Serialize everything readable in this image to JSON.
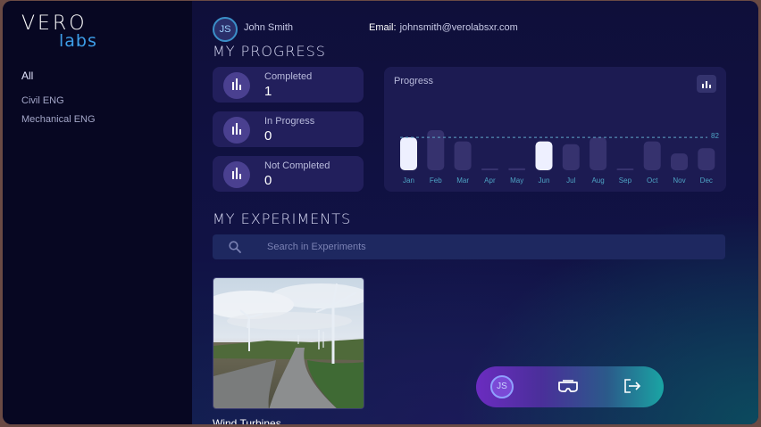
{
  "brand": {
    "name_top": "VERO",
    "name_bottom": "labs"
  },
  "sidebar": {
    "items": [
      {
        "label": "All",
        "active": true
      },
      {
        "label": "Civil ENG",
        "active": false
      },
      {
        "label": "Mechanical ENG",
        "active": false
      }
    ]
  },
  "user": {
    "initials": "JS",
    "name": "John Smith",
    "email_label": "Email:",
    "email": "johnsmith@verolabsxr.com"
  },
  "progress_section": {
    "title": "MY PROGRESS",
    "stats": [
      {
        "label": "Completed",
        "value": "1"
      },
      {
        "label": "In Progress",
        "value": "0"
      },
      {
        "label": "Not Completed",
        "value": "0"
      }
    ]
  },
  "chart_data": {
    "type": "bar",
    "title": "Progress",
    "categories": [
      "Jan",
      "Feb",
      "Mar",
      "Apr",
      "May",
      "Jun",
      "Jul",
      "Aug",
      "Sep",
      "Oct",
      "Nov",
      "Dec"
    ],
    "values": [
      82,
      100,
      72,
      0,
      5,
      72,
      65,
      82,
      3,
      72,
      42,
      55
    ],
    "highlighted": [
      true,
      false,
      false,
      false,
      false,
      true,
      false,
      false,
      false,
      false,
      false,
      false
    ],
    "reference_line": {
      "value": 82,
      "label": "82"
    },
    "ylim": [
      0,
      100
    ],
    "colors": {
      "bar": "#36326e",
      "highlight": "#eef0ff",
      "axis_label": "#4ea3c4",
      "ref_line": "#5fa6c8"
    }
  },
  "experiments_section": {
    "title": "MY EXPERIMENTS",
    "search_placeholder": "Search in Experiments",
    "items": [
      {
        "title": "Wind Turbines"
      }
    ]
  },
  "dock": {
    "initials": "JS",
    "vr_icon": "vr-headset-icon",
    "exit_icon": "exit-icon"
  }
}
